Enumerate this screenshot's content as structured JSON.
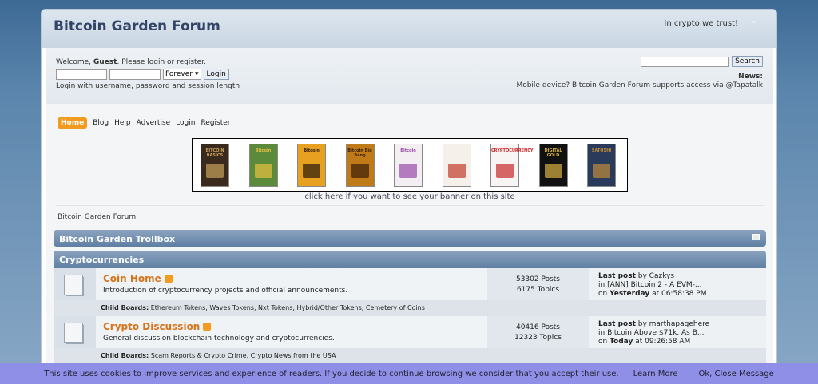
{
  "header": {
    "title": "Bitcoin Garden Forum",
    "motto": "In crypto we trust!",
    "collapse_icon": "chevron-up-icon"
  },
  "user": {
    "welcome_prefix": "Welcome,",
    "guest": "Guest",
    "welcome_suffix": ". Please login or register.",
    "duration": "Forever",
    "login_button": "Login",
    "hint": "Login with username, password and session length"
  },
  "search": {
    "button": "Search",
    "news_label": "News:",
    "news_text": "Mobile device? Bitcoin Garden Forum supports access via @Tapatalk"
  },
  "menu": [
    "Home",
    "Blog",
    "Help",
    "Advertise",
    "Login",
    "Register"
  ],
  "banner": {
    "books": [
      {
        "color": "#3a2a1e",
        "accent": "#c9a25a",
        "text": "BITCOIN BASICS"
      },
      {
        "color": "#5a8a3a",
        "accent": "#e8c040",
        "text": "Bitcoin"
      },
      {
        "color": "#e8a020",
        "accent": "#2a1a0a",
        "text": "Bitcoin"
      },
      {
        "color": "#c07a18",
        "accent": "#3a2008",
        "text": "Bitcoin Big Bang"
      },
      {
        "color": "#f2eef2",
        "accent": "#9a4aa8",
        "text": "Bitcoin"
      },
      {
        "color": "#f5f0ea",
        "accent": "#c23a2a",
        "text": ""
      },
      {
        "color": "#f8f4f4",
        "accent": "#c8282a",
        "text": "CRYPTOCURRENCY"
      },
      {
        "color": "#111111",
        "accent": "#d8b040",
        "text": "DIGITAL GOLD"
      },
      {
        "color": "#2a3a5a",
        "accent": "#c08a3a",
        "text": "SATOSHI"
      }
    ],
    "link": "click here if you want to see your banner on this site"
  },
  "breadcrumb": "Bitcoin Garden Forum",
  "categories": {
    "trollbox": "Bitcoin Garden Trollbox",
    "crypto": "Cryptocurrencies"
  },
  "boards": [
    {
      "name": "Coin Home",
      "desc": "Introduction of cryptocurrency projects and official announcements.",
      "posts": "53302 Posts",
      "topics": "6175 Topics",
      "last_label": "Last post",
      "last_by": "by Cazkys",
      "last_in": "in [ANN] Bitcoin 2 - A EVM-...",
      "last_on": "on",
      "last_day": "Yesterday",
      "last_time": "at 06:58:38 PM",
      "child_label": "Child Boards:",
      "children": "Ethereum Tokens, Waves Tokens, Nxt Tokens, Hybrid/Other Tokens, Cemetery of Coins"
    },
    {
      "name": "Crypto Discussion",
      "desc": "General discussion blockchain technology and cryptocurrencies.",
      "posts": "40416 Posts",
      "topics": "12323 Topics",
      "last_label": "Last post",
      "last_by": "by marthapagehere",
      "last_in": "in Bitcoin Above $71k, As B...",
      "last_on": "on",
      "last_day": "Today",
      "last_time": "at 09:26:58 AM",
      "child_label": "Child Boards:",
      "children": "Scam Reports & Crypto Crime, Crypto News from the USA"
    }
  ],
  "cookie": {
    "text": "This site uses cookies to improve services and experience of readers. If you decide to continue browsing we consider that you accept their use.",
    "learn": "Learn More",
    "ok": "Ok, Close Message"
  }
}
